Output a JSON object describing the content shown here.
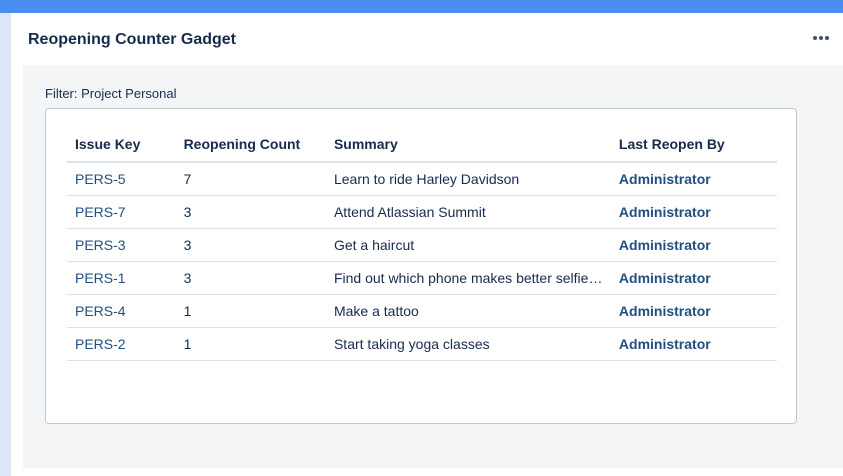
{
  "gadget": {
    "title": "Reopening Counter Gadget",
    "menu_icon": "more-horizontal-icon"
  },
  "filter": {
    "label": "Filter: Project Personal"
  },
  "table": {
    "headers": {
      "issue_key": "Issue Key",
      "reopening_count": "Reopening Count",
      "summary": "Summary",
      "last_reopen_by": "Last Reopen By"
    },
    "rows": [
      {
        "key": "PERS-5",
        "count": "7",
        "summary": "Learn to ride Harley Davidson",
        "user": "Administrator"
      },
      {
        "key": "PERS-7",
        "count": "3",
        "summary": "Attend Atlassian Summit",
        "user": "Administrator"
      },
      {
        "key": "PERS-3",
        "count": "3",
        "summary": "Get a haircut",
        "user": "Administrator"
      },
      {
        "key": "PERS-1",
        "count": "3",
        "summary": "Find out which phone makes better selfie…",
        "user": "Administrator"
      },
      {
        "key": "PERS-4",
        "count": "1",
        "summary": "Make a tattoo",
        "user": "Administrator"
      },
      {
        "key": "PERS-2",
        "count": "1",
        "summary": "Start taking yoga classes",
        "user": "Administrator"
      }
    ]
  },
  "colors": {
    "top_bar": "#4a8ef0",
    "link": "#205081",
    "text": "#172b4d"
  }
}
